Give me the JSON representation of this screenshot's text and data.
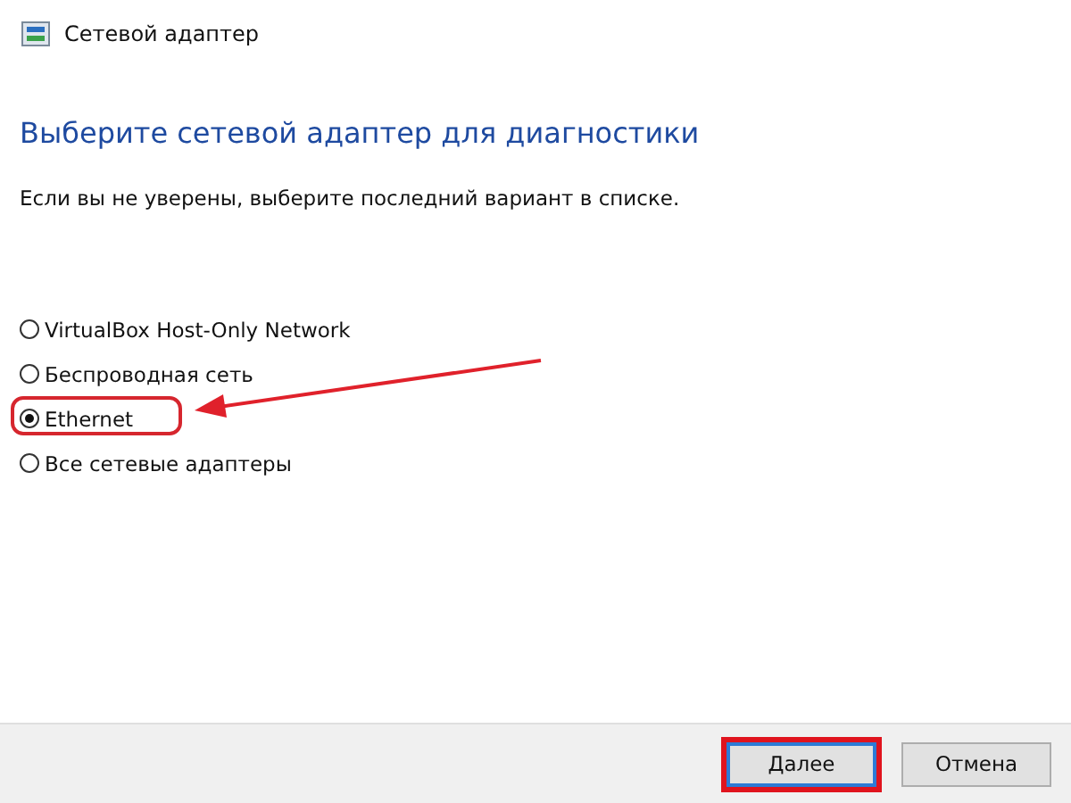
{
  "window": {
    "title": "Сетевой адаптер"
  },
  "heading": "Выберите сетевой адаптер для диагностики",
  "instruction": "Если вы не уверены, выберите последний вариант в списке.",
  "options": [
    {
      "label": "VirtualBox Host-Only Network",
      "selected": false,
      "highlighted": false
    },
    {
      "label": "Беспроводная сеть",
      "selected": false,
      "highlighted": false
    },
    {
      "label": "Ethernet",
      "selected": true,
      "highlighted": true
    },
    {
      "label": "Все сетевые адаптеры",
      "selected": false,
      "highlighted": false
    }
  ],
  "buttons": [
    {
      "label": "Далее",
      "default": true,
      "highlighted": true
    },
    {
      "label": "Отмена",
      "default": false,
      "highlighted": false
    }
  ]
}
